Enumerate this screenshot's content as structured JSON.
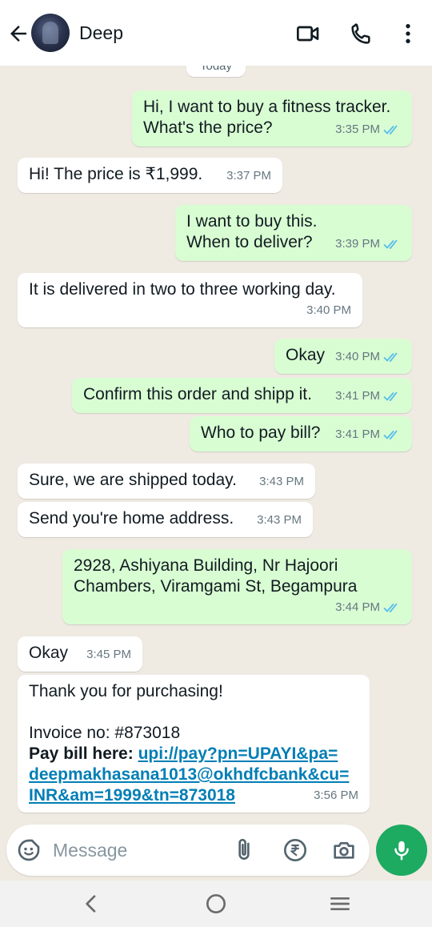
{
  "header": {
    "contact_name": "Deep"
  },
  "chat": {
    "date_chip": "Today",
    "messages": [
      {
        "dir": "out",
        "text": "Hi, I want to buy a fitness tracker.\nWhat's the price?",
        "time": "3:35 PM",
        "status": "read"
      },
      {
        "dir": "in",
        "text": "Hi! The price is ₹1,999.",
        "time": "3:37 PM"
      },
      {
        "dir": "out",
        "text": "I want to buy this.\nWhen to deliver?",
        "time": "3:39 PM",
        "status": "read"
      },
      {
        "dir": "in",
        "text": "It is delivered in two to three working day.",
        "time": "3:40 PM"
      },
      {
        "dir": "out",
        "text": "Okay",
        "time": "3:40 PM",
        "status": "read"
      },
      {
        "dir": "out",
        "text": "Confirm this order and shipp it.",
        "time": "3:41 PM",
        "status": "read"
      },
      {
        "dir": "out",
        "text": "Who to pay bill?",
        "time": "3:41 PM",
        "status": "read"
      },
      {
        "dir": "in",
        "text": "Sure, we are shipped today.",
        "time": "3:43 PM"
      },
      {
        "dir": "in",
        "text": "Send you're home address.",
        "time": "3:43 PM"
      },
      {
        "dir": "out",
        "text": "2928, Ashiyana Building, Nr Hajoori\nChambers, Viramgami St, Begampura",
        "time": "3:44 PM",
        "status": "read"
      },
      {
        "dir": "in",
        "text": "Okay",
        "time": "3:45 PM"
      },
      {
        "dir": "in",
        "line1": "Thank you for purchasing!",
        "line2": "Invoice no: #873018",
        "pay_label": "Pay bill here:",
        "link_part1": "upi://pay?pn=UPAYI&pa=",
        "link_part2": "deepmakhasana1013@okhdfcbank&cu=",
        "link_part3": "INR&am=1999&tn=873018",
        "time": "3:56 PM"
      }
    ]
  },
  "input": {
    "placeholder": "Message"
  },
  "colors": {
    "outgoing_bubble": "#d9fdd3",
    "incoming_bubble": "#ffffff",
    "accent_green": "#1daa61",
    "read_tick": "#53bdeb",
    "link": "#027eb5"
  },
  "icons": [
    "back-arrow-icon",
    "video-call-icon",
    "phone-icon",
    "more-vert-icon",
    "sticker-icon",
    "attach-icon",
    "rupee-icon",
    "camera-icon",
    "mic-icon",
    "nav-back-icon",
    "nav-home-icon",
    "nav-recents-icon"
  ]
}
